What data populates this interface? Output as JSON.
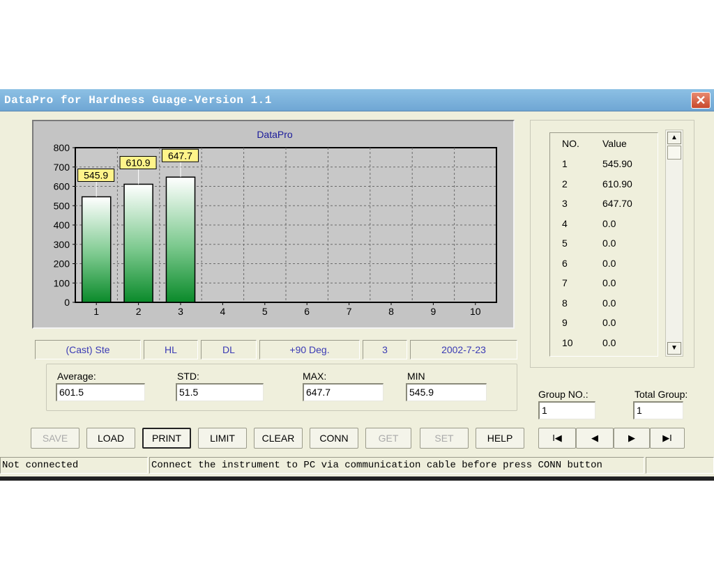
{
  "window": {
    "title": "DataPro for Hardness Guage-Version 1.1",
    "close_label": "✕"
  },
  "chart_data": {
    "type": "bar",
    "title": "DataPro",
    "categories": [
      "1",
      "2",
      "3",
      "4",
      "5",
      "6",
      "7",
      "8",
      "9",
      "10"
    ],
    "values": [
      545.9,
      610.9,
      647.7,
      0,
      0,
      0,
      0,
      0,
      0,
      0
    ],
    "data_labels": [
      "545.9",
      "610.9",
      "647.7"
    ],
    "ylim": [
      0,
      800
    ],
    "yticks": [
      0,
      100,
      200,
      300,
      400,
      500,
      600,
      700,
      800
    ],
    "grid": true,
    "colors": {
      "bar_top": "#ffffff",
      "bar_bottom": "#0a8a2a",
      "label_bg": "#fff48a",
      "title": "#1a1a9a"
    }
  },
  "info": {
    "material": "(Cast) Ste",
    "scale1": "HL",
    "scale2": "DL",
    "direction": "+90 Deg.",
    "count": "3",
    "date": "2002-7-23"
  },
  "stats": {
    "average_label": "Average:",
    "average": "601.5",
    "std_label": "STD:",
    "std": "51.5",
    "max_label": "MAX:",
    "max": "647.7",
    "min_label": "MIN",
    "min": "545.9"
  },
  "table": {
    "headers": [
      "NO.",
      "Value"
    ],
    "rows": [
      [
        "1",
        "545.90"
      ],
      [
        "2",
        "610.90"
      ],
      [
        "3",
        "647.70"
      ],
      [
        "4",
        "0.0"
      ],
      [
        "5",
        "0.0"
      ],
      [
        "6",
        "0.0"
      ],
      [
        "7",
        "0.0"
      ],
      [
        "8",
        "0.0"
      ],
      [
        "9",
        "0.0"
      ],
      [
        "10",
        "0.0"
      ]
    ]
  },
  "group": {
    "group_no_label": "Group NO.:",
    "group_no": "1",
    "total_label": "Total Group:",
    "total": "1"
  },
  "buttons": {
    "save": "SAVE",
    "load": "LOAD",
    "print": "PRINT",
    "limit": "LIMIT",
    "clear": "CLEAR",
    "conn": "CONN",
    "get": "GET",
    "set": "SET",
    "help": "HELP"
  },
  "nav": {
    "first": "I◀",
    "prev": "◀",
    "next": "▶",
    "last": "▶I"
  },
  "status": {
    "left": "Not connected",
    "message": "Connect the instrument to PC via communication cable before press CONN button"
  }
}
